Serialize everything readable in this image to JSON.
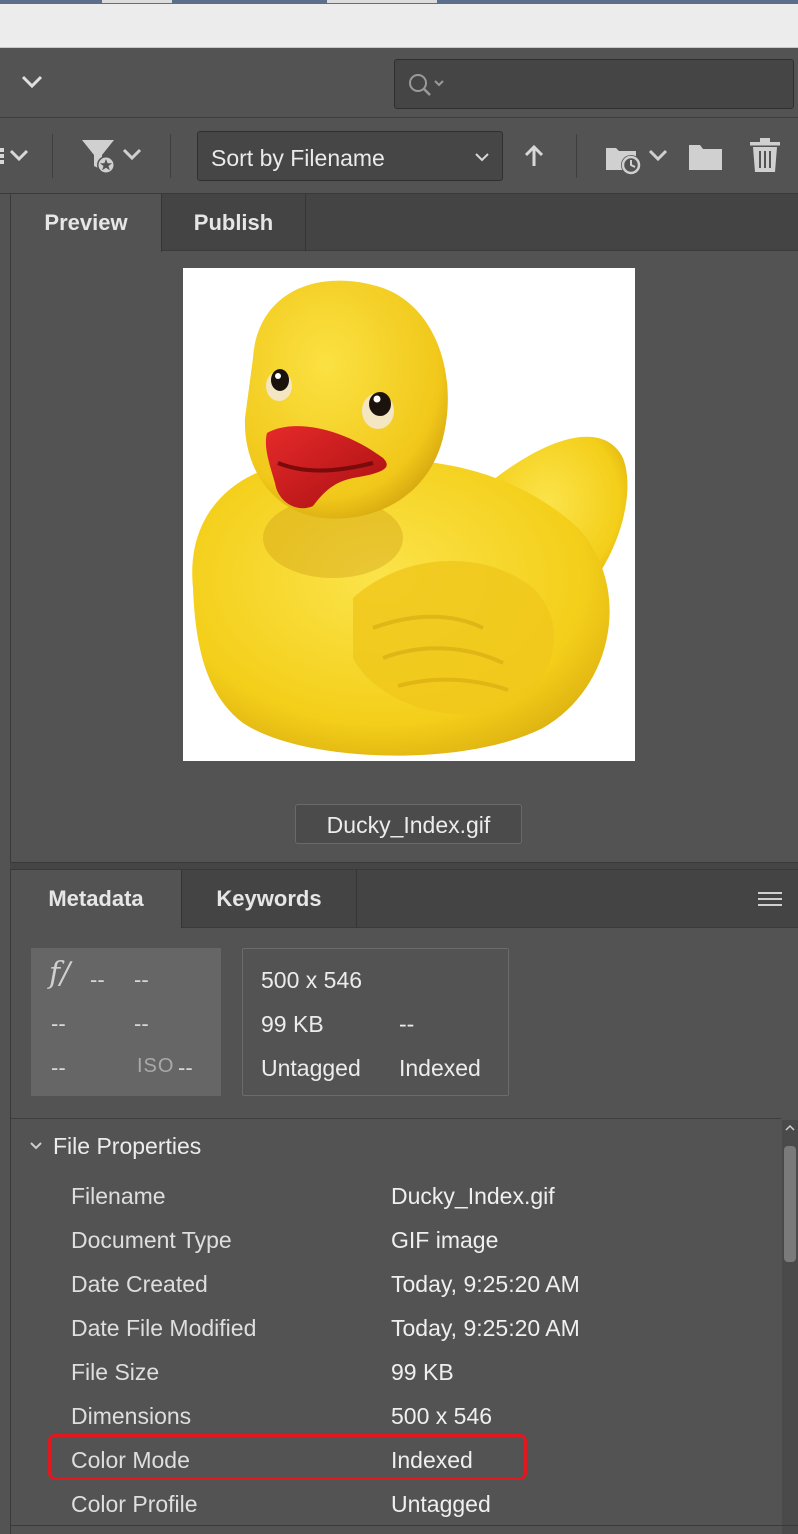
{
  "toolbar": {
    "sort_label": "Sort by Filename"
  },
  "preview": {
    "tabs": [
      {
        "label": "Preview",
        "active": true
      },
      {
        "label": "Publish",
        "active": false
      }
    ],
    "filename": "Ducky_Index.gif"
  },
  "metadata": {
    "tabs": [
      {
        "label": "Metadata",
        "active": true
      },
      {
        "label": "Keywords",
        "active": false
      }
    ],
    "camera": {
      "aperture_label": "f/",
      "aperture": "--",
      "shutter": "--",
      "r2c1": "--",
      "r2c2": "--",
      "r3c1": "--",
      "iso_label": "ISO",
      "iso": "--"
    },
    "file_info": {
      "dimensions": "500 x 546",
      "size": "99 KB",
      "size_extra": "--",
      "profile": "Untagged",
      "mode": "Indexed"
    },
    "section_title": "File Properties",
    "properties": [
      {
        "key": "Filename",
        "value": "Ducky_Index.gif"
      },
      {
        "key": "Document Type",
        "value": "GIF image"
      },
      {
        "key": "Date Created",
        "value": "Today, 9:25:20 AM"
      },
      {
        "key": "Date File Modified",
        "value": "Today, 9:25:20 AM"
      },
      {
        "key": "File Size",
        "value": "99 KB"
      },
      {
        "key": "Dimensions",
        "value": "500 x 546"
      },
      {
        "key": "Color Mode",
        "value": "Indexed"
      },
      {
        "key": "Color Profile",
        "value": "Untagged"
      }
    ]
  },
  "colors": {
    "panel_bg": "#535353",
    "tab_bg": "#444444",
    "highlight": "#e0191f",
    "duck_yellow": "#f6d21f",
    "beak_red": "#d41a1a"
  },
  "icons": [
    "chevron-down-icon",
    "search-icon",
    "filter-star-icon",
    "sort-up-arrow-icon",
    "recent-folder-icon",
    "folder-icon",
    "trash-icon",
    "panel-menu-icon"
  ]
}
